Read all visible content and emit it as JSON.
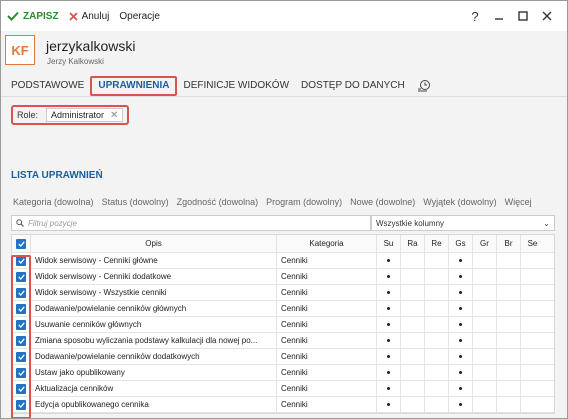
{
  "toolbar": {
    "save_label": "ZAPISZ",
    "cancel_label": "Anuluj",
    "operations_label": "Operacje",
    "help_label": "?"
  },
  "user": {
    "initials": "KF",
    "username": "jerzykalkowski",
    "full_name": "Jerzy Kalkowski",
    "avatar_color": "#e07a3a"
  },
  "tabs": [
    {
      "label": "PODSTAWOWE"
    },
    {
      "label": "UPRAWNIENIA"
    },
    {
      "label": "DEFINICJE WIDOKÓW"
    },
    {
      "label": "DOSTĘP DO DANYCH"
    }
  ],
  "active_tab": "UPRAWNIENIA",
  "role": {
    "label": "Role:",
    "value": "Administrator"
  },
  "list_title": "LISTA UPRAWNIEŃ",
  "filters": [
    "Kategoria (dowolna)",
    "Status (dowolny)",
    "Zgodność (dowolna)",
    "Program (dowolny)",
    "Nowe (dowolne)",
    "Wyjątek (dowolny)",
    "Więcej"
  ],
  "search": {
    "placeholder": "Filtruj pozycje",
    "columns_select": "Wszystkie kolumny"
  },
  "table": {
    "headers": {
      "opis": "Opis",
      "kategoria": "Kategoria",
      "perms": [
        "Su",
        "Ra",
        "Re",
        "Gs",
        "Gr",
        "Br",
        "Se"
      ]
    },
    "rows": [
      {
        "checked": true,
        "opis": "Widok serwisowy - Cenniki główne",
        "kategoria": "Cenniki",
        "perms": [
          1,
          0,
          0,
          1,
          0,
          0,
          0
        ]
      },
      {
        "checked": true,
        "opis": "Widok serwisowy - Cenniki dodatkowe",
        "kategoria": "Cenniki",
        "perms": [
          1,
          0,
          0,
          1,
          0,
          0,
          0
        ]
      },
      {
        "checked": true,
        "opis": "Widok serwisowy - Wszystkie cenniki",
        "kategoria": "Cenniki",
        "perms": [
          1,
          0,
          0,
          1,
          0,
          0,
          0
        ]
      },
      {
        "checked": true,
        "opis": "Dodawanie/powielanie cenników głównych",
        "kategoria": "Cenniki",
        "perms": [
          1,
          0,
          0,
          1,
          0,
          0,
          0
        ]
      },
      {
        "checked": true,
        "opis": "Usuwanie cenników głównych",
        "kategoria": "Cenniki",
        "perms": [
          1,
          0,
          0,
          1,
          0,
          0,
          0
        ]
      },
      {
        "checked": true,
        "opis": "Zmiana sposobu wyliczania podstawy kalkulacji dla nowej po...",
        "kategoria": "Cenniki",
        "perms": [
          1,
          0,
          0,
          1,
          0,
          0,
          0
        ]
      },
      {
        "checked": true,
        "opis": "Dodawanie/powielanie cenników dodatkowych",
        "kategoria": "Cenniki",
        "perms": [
          1,
          0,
          0,
          1,
          0,
          0,
          0
        ]
      },
      {
        "checked": true,
        "opis": "Ustaw jako opublikowany",
        "kategoria": "Cenniki",
        "perms": [
          1,
          0,
          0,
          1,
          0,
          0,
          0
        ]
      },
      {
        "checked": true,
        "opis": "Aktualizacja cenników",
        "kategoria": "Cenniki",
        "perms": [
          1,
          0,
          0,
          1,
          0,
          0,
          0
        ]
      },
      {
        "checked": true,
        "opis": "Edycja opublikowanego cennika",
        "kategoria": "Cenniki",
        "perms": [
          1,
          0,
          0,
          1,
          0,
          0,
          0
        ]
      }
    ]
  },
  "colors": {
    "accent": "#1b5e9c",
    "checkbox": "#1f74c7",
    "highlight": "#d9534f",
    "save": "#2b8a2b"
  }
}
